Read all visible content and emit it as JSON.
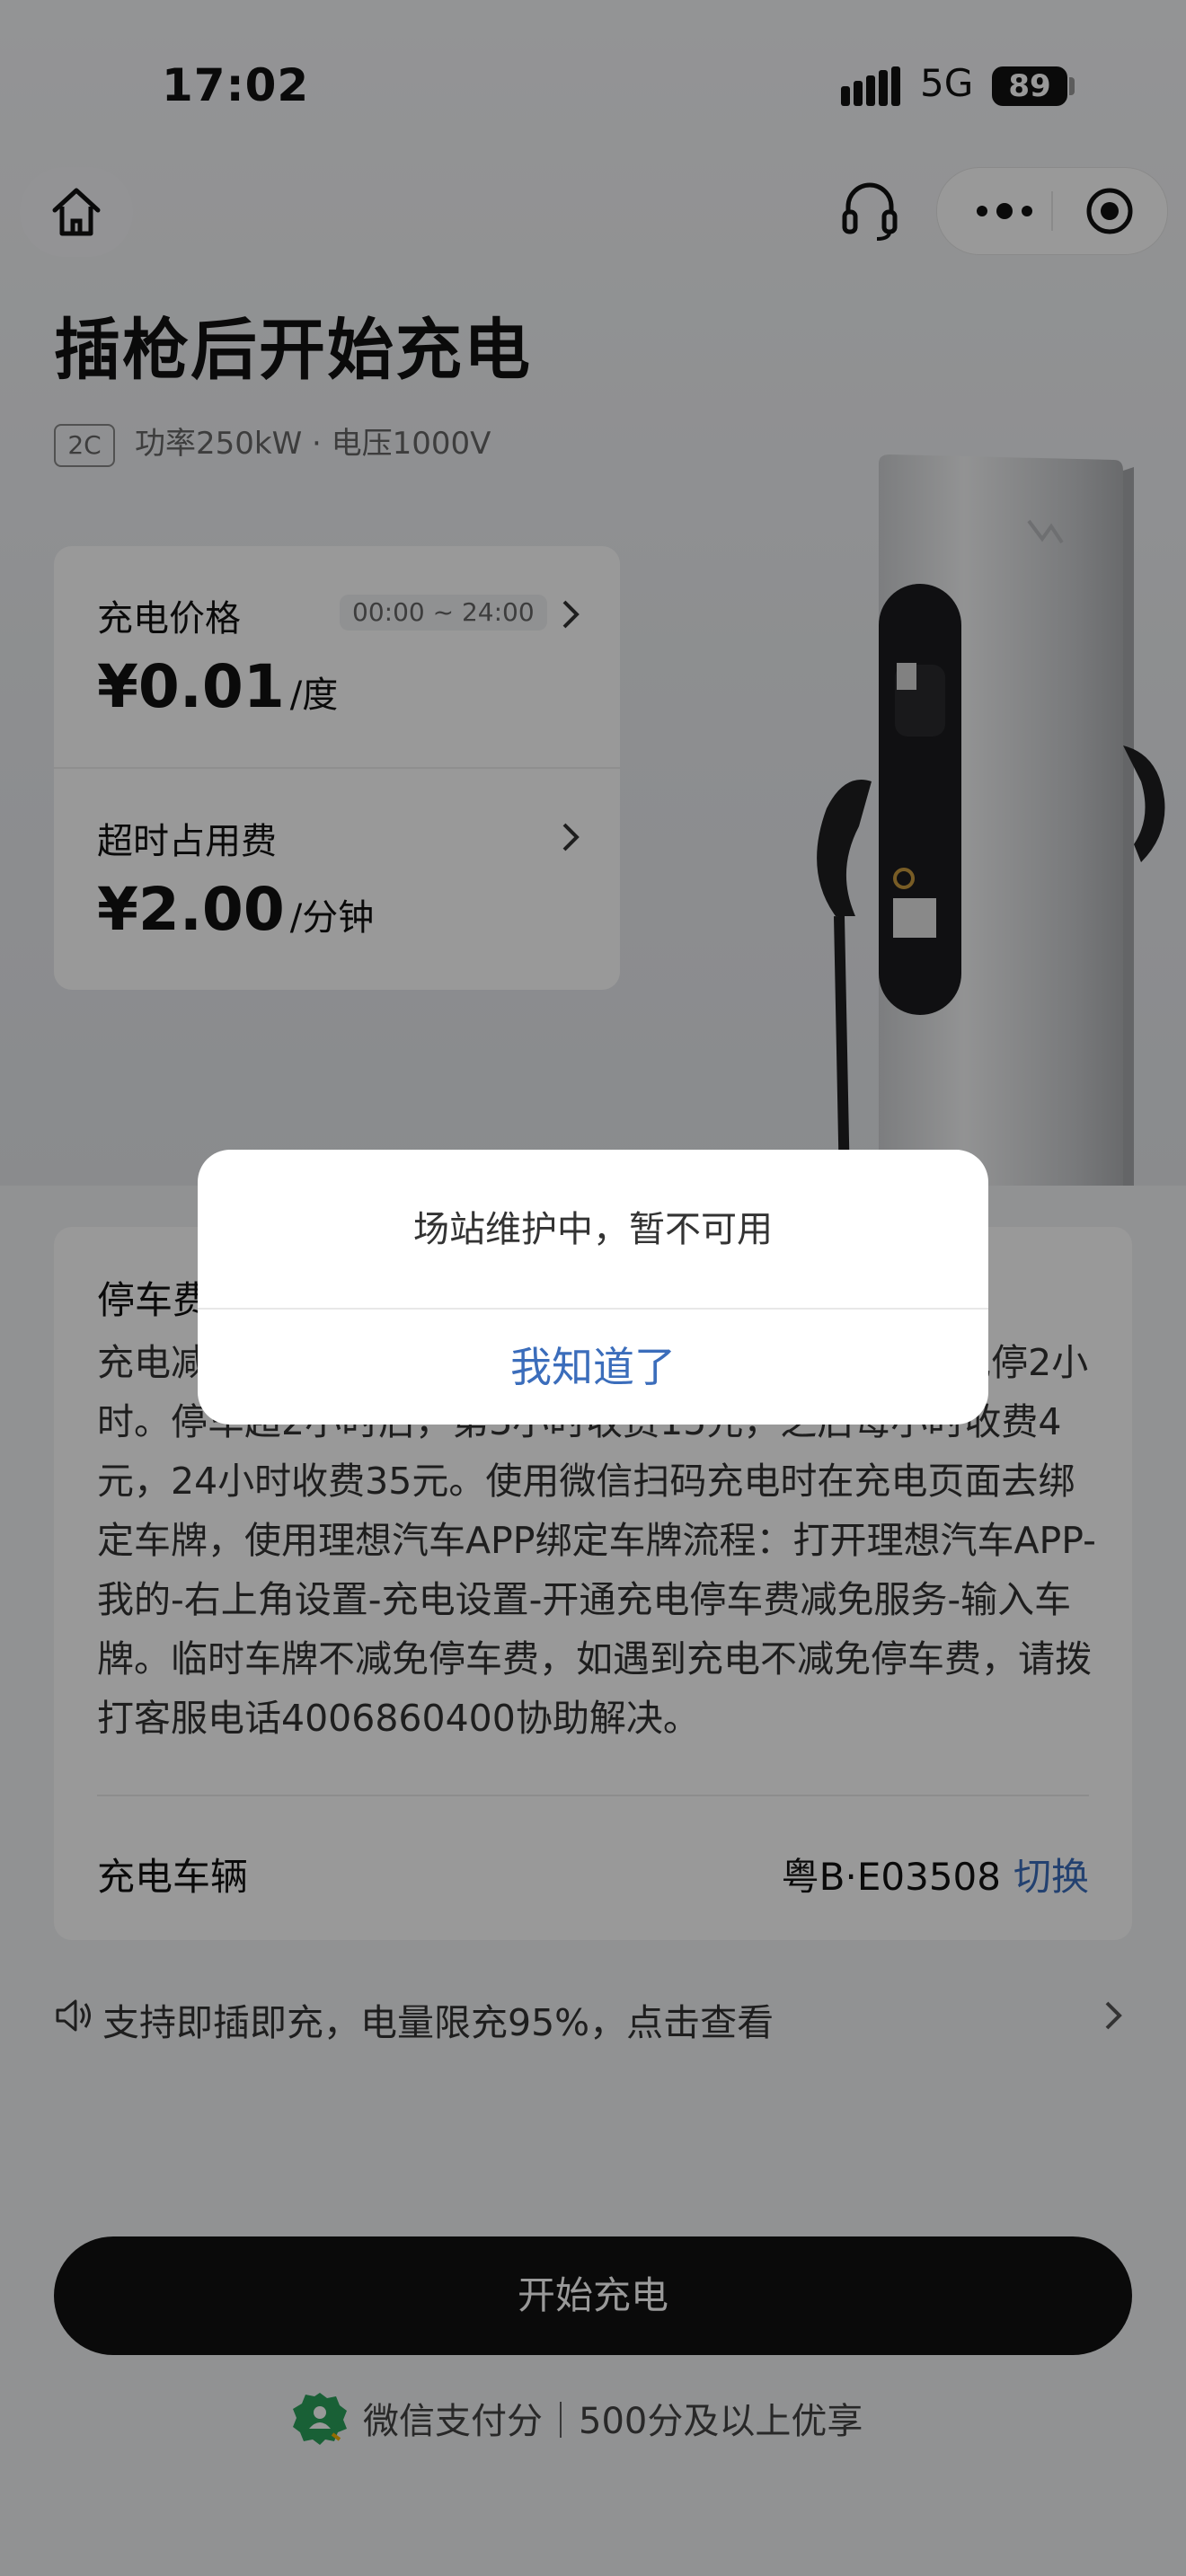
{
  "status_bar": {
    "time": "17:02",
    "network": "5G",
    "battery": "89"
  },
  "header": {
    "title": "插枪后开始充电"
  },
  "spec": {
    "badge": "2C",
    "text": "功率250kW · 电压1000V"
  },
  "pricing": {
    "charge": {
      "label": "充电价格",
      "time_range": "00:00 ~ 24:00",
      "price": "¥0.01",
      "unit": "/度"
    },
    "overtime": {
      "label": "超时占用费",
      "price": "¥2.00",
      "unit": "/分钟"
    }
  },
  "parking": {
    "title": "停车费",
    "body": "充电减免停车费：充电时间大于15分钟，绑定车牌可免停2小时。停车超2小时后，第3小时收费15元，之后每小时收费4元，24小时收费35元。使用微信扫码充电时在充电页面去绑定车牌，使用理想汽车APP绑定车牌流程：打开理想汽车APP-我的-右上角设置-充电设置-开通充电停车费减免服务-输入车牌。临时车牌不减免停车费，如遇到充电不减免停车费，请拨打客服电话4006860400协助解决。"
  },
  "vehicle": {
    "label": "充电车辆",
    "plate": "粤B·E03508",
    "switch_label": "切换"
  },
  "notice": {
    "text": "支持即插即充，电量限充95%，点击查看"
  },
  "actions": {
    "start_label": "开始充电"
  },
  "payment": {
    "text": "微信支付分｜500分及以上优享"
  },
  "dialog": {
    "message": "场站维护中，暂不可用",
    "confirm_label": "我知道了"
  },
  "colors": {
    "accent": "#3b6dbb",
    "button": "#111111",
    "pay_green": "#2aa05a"
  },
  "icons": {
    "home": "home-icon",
    "headset": "headset-icon",
    "more": "more-dots-icon",
    "close": "target-icon",
    "speaker": "speaker-icon",
    "chevron": "chevron-right-icon"
  }
}
